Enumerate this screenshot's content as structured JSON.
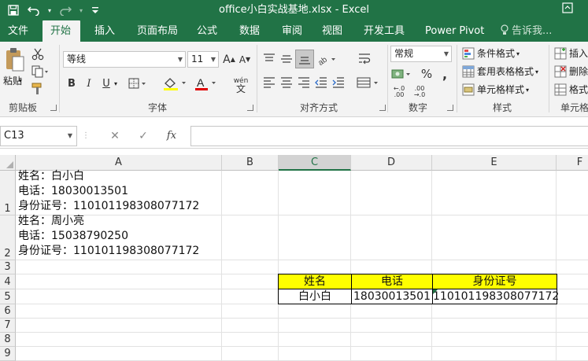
{
  "window": {
    "title": "office小白实战基地.xlsx - Excel"
  },
  "quick_access": {
    "icons": [
      "save-icon",
      "undo-icon",
      "redo-icon",
      "customize-icon"
    ]
  },
  "tabs": [
    {
      "label": "文件"
    },
    {
      "label": "开始"
    },
    {
      "label": "插入"
    },
    {
      "label": "页面布局"
    },
    {
      "label": "公式"
    },
    {
      "label": "数据"
    },
    {
      "label": "审阅"
    },
    {
      "label": "视图"
    },
    {
      "label": "开发工具"
    },
    {
      "label": "Power Pivot"
    },
    {
      "label": "告诉我..."
    }
  ],
  "active_tab": "开始",
  "ribbon": {
    "clipboard": {
      "label": "剪贴板",
      "paste": "粘贴"
    },
    "font": {
      "label": "字体",
      "name": "等线",
      "size": "11",
      "bold": "B",
      "italic": "I",
      "underline": "U",
      "grow": "A",
      "shrink": "A",
      "phonetic": "wén"
    },
    "alignment": {
      "label": "对齐方式"
    },
    "number": {
      "label": "数字",
      "format": "常规",
      "percent": "%",
      "comma": ","
    },
    "styles": {
      "label": "样式",
      "conditional": "条件格式",
      "table": "套用表格格式",
      "cell": "单元格样式"
    },
    "cells": {
      "label": "单元格",
      "insert": "插入",
      "delete": "删除",
      "format": "格式"
    }
  },
  "formula_bar": {
    "name_box": "C13",
    "fx": "fx",
    "value": ""
  },
  "grid": {
    "columns": [
      "A",
      "B",
      "C",
      "D",
      "E",
      "F"
    ],
    "selected_column": "C",
    "rows": [
      "1",
      "2",
      "3",
      "4",
      "5",
      "6",
      "7",
      "8",
      "9"
    ],
    "A1": [
      "姓名：白小白",
      "电话：18030013501",
      "身份证号：110101198308077172"
    ],
    "A2": [
      "姓名：周小亮",
      "电话：15038790250",
      "身份证号：110101198308077172"
    ],
    "table": {
      "headers": [
        "姓名",
        "电话",
        "身份证号"
      ],
      "row": [
        "白小白",
        "18030013501",
        "110101198308077172"
      ],
      "header_color": "#ffff00"
    }
  },
  "colors": {
    "accent": "#217346"
  }
}
